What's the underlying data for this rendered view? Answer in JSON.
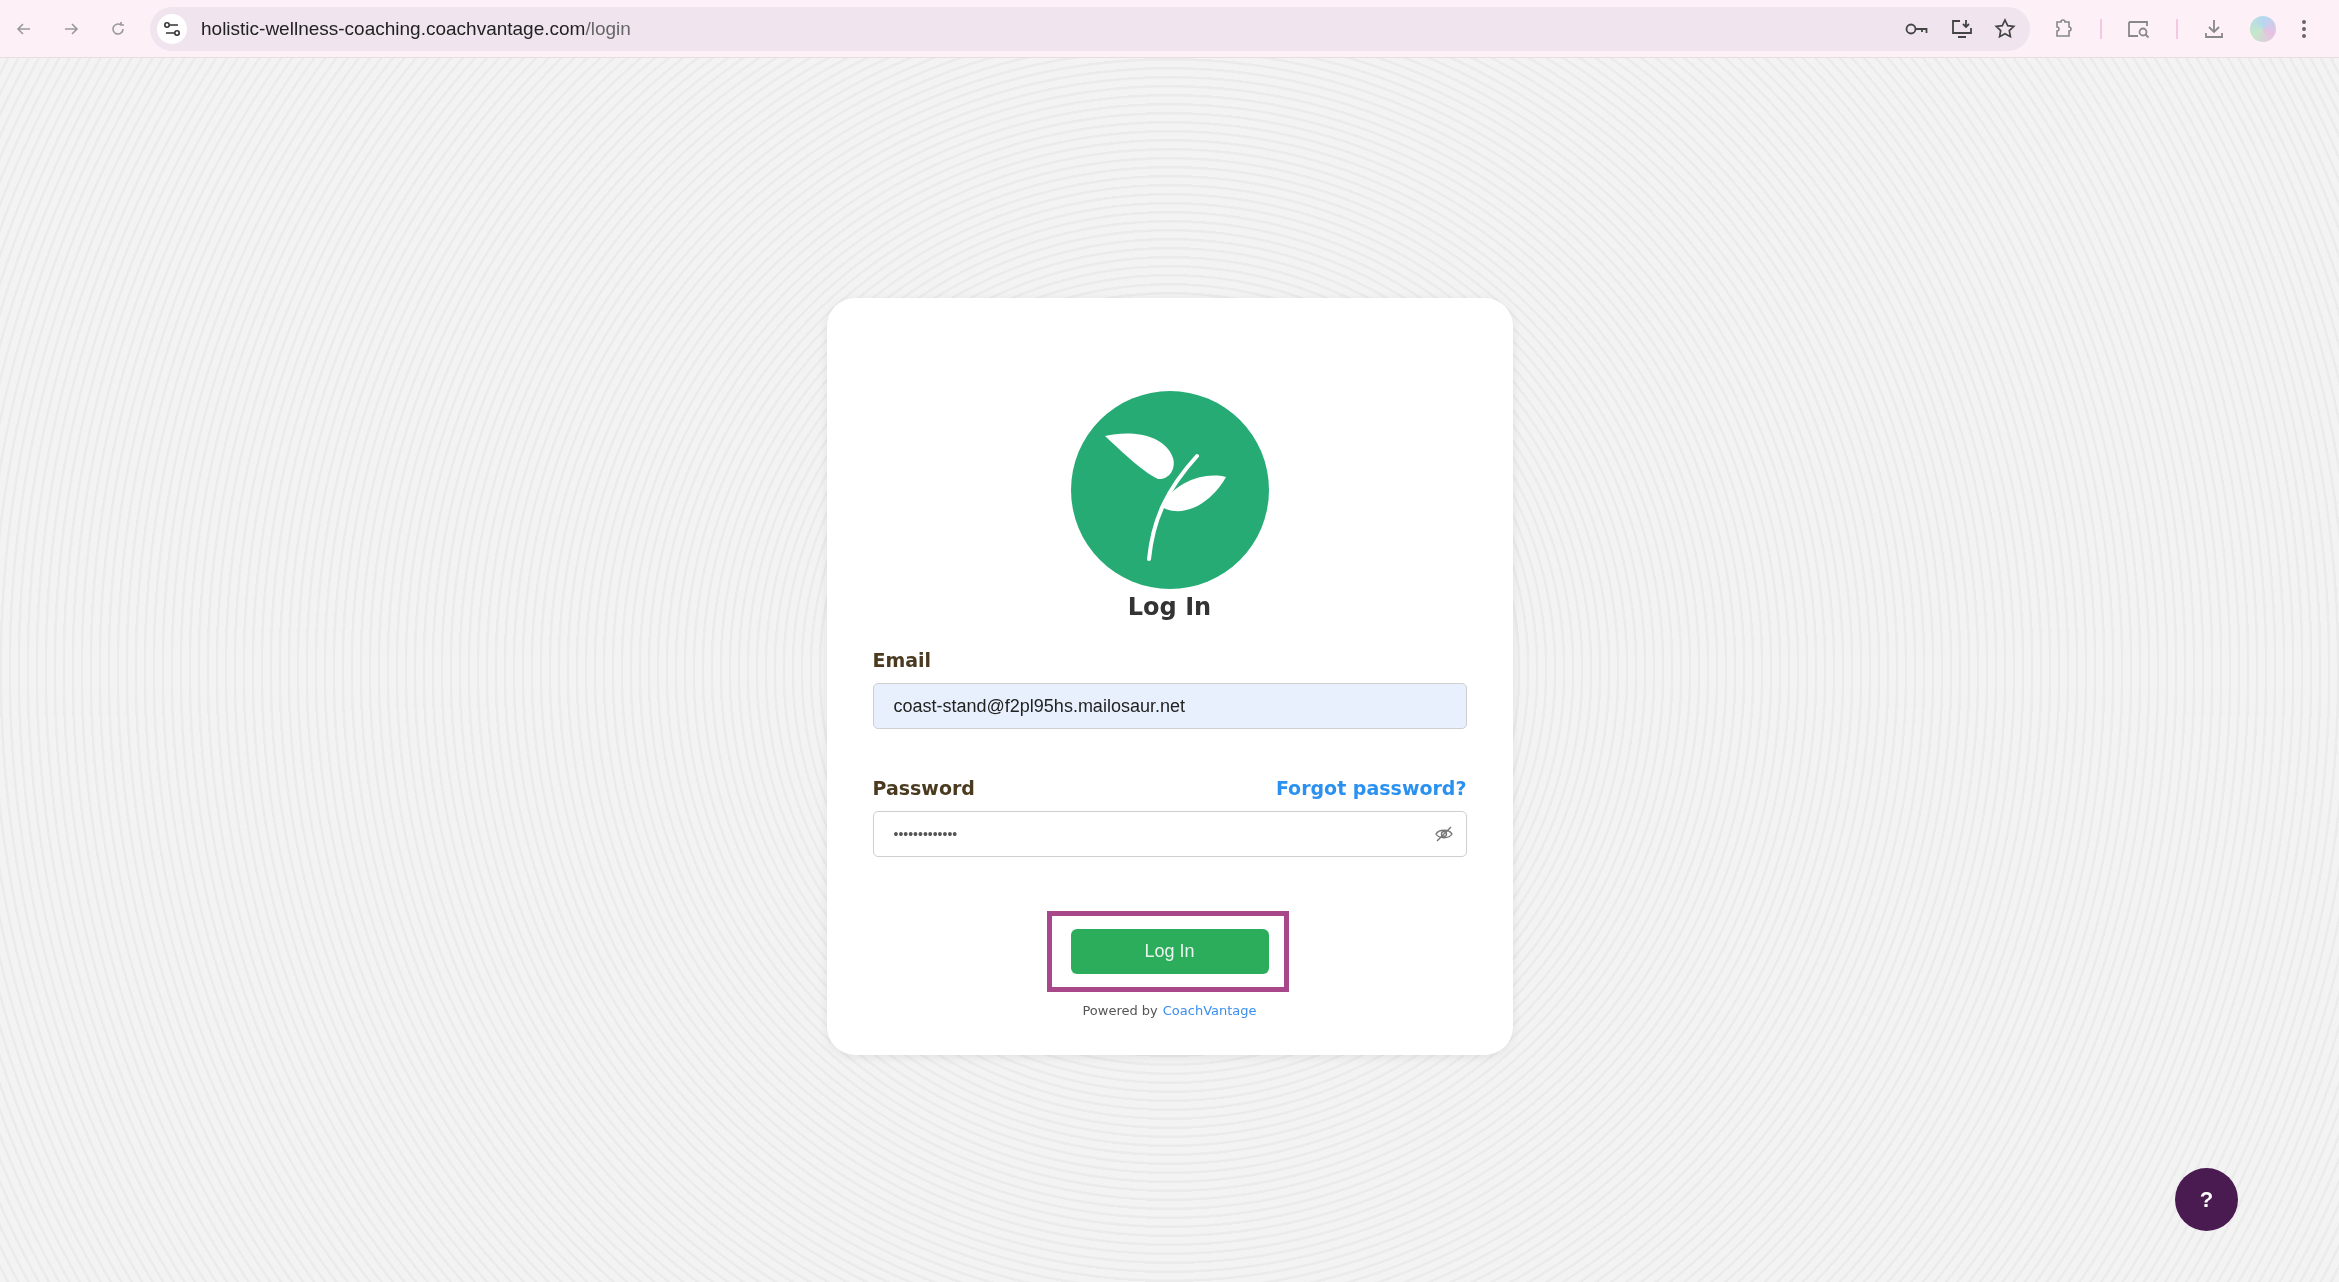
{
  "browser": {
    "url_host": "holistic-wellness-coaching.coachvantage.com",
    "url_path": "/login"
  },
  "login": {
    "title": "Log In",
    "email": {
      "label": "Email",
      "value": "coast-stand@f2pl95hs.mailosaur.net"
    },
    "password": {
      "label": "Password",
      "value": "•••••••••••••",
      "forgot": "Forgot password?"
    },
    "submit": {
      "label": "Log In",
      "highlighted": true
    },
    "powered_by": {
      "prefix": "Powered by",
      "brand": "CoachVantage"
    }
  },
  "help": {
    "label": "?"
  }
}
